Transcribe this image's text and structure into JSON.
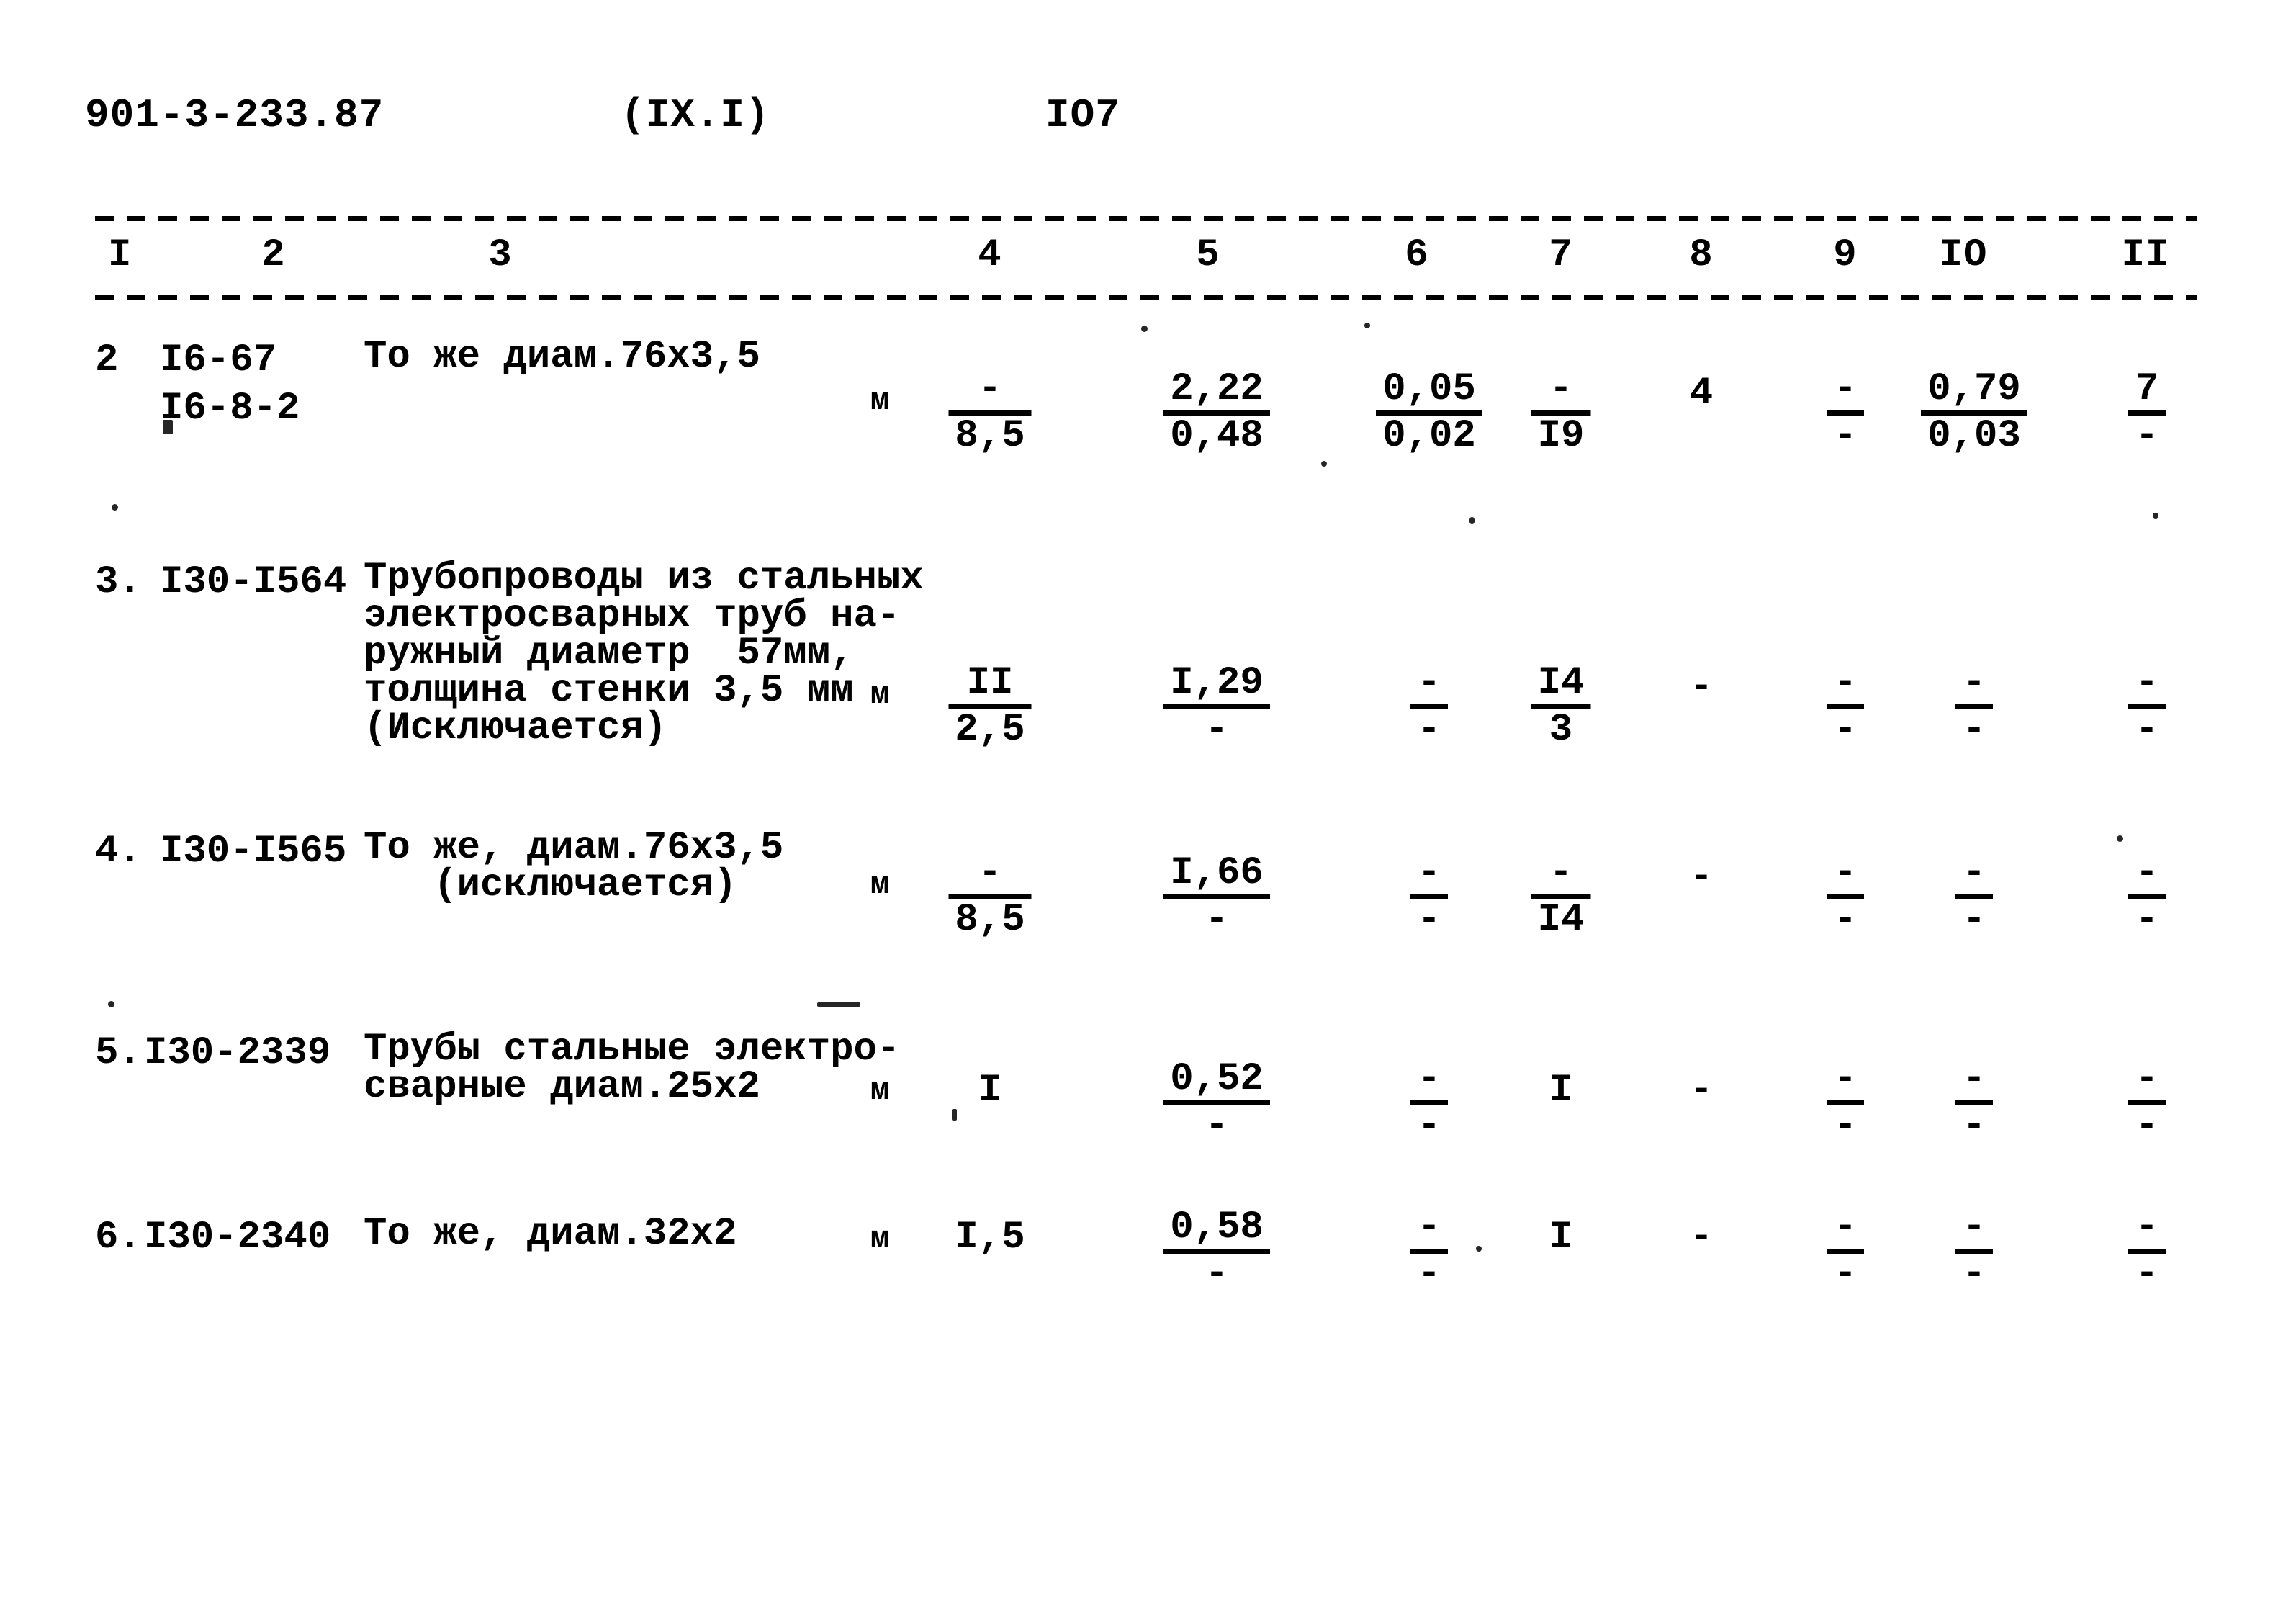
{
  "header": {
    "doc_code": "901-3-233.87",
    "section": "(IX.I)",
    "page_number": "IO7"
  },
  "table": {
    "column_headers": [
      "I",
      "2",
      "3",
      "4",
      "5",
      "6",
      "7",
      "8",
      "9",
      "IO",
      "II"
    ],
    "rows": [
      {
        "no": "2",
        "code_line1": "I6-67",
        "code_line2": "I6-8-2",
        "description": "То же диам.76х3,5",
        "unit": "м",
        "c4_top": "-",
        "c4_bot": "8,5",
        "c5_top": "2,22",
        "c5_bot": "0,48",
        "c6_top": "0,05",
        "c6_bot": "0,02",
        "c7_top": "-",
        "c7_bot": "I9",
        "c8": "4",
        "c9_top": "-",
        "c9_bot": "-",
        "c10_top": "0,79",
        "c10_bot": "0,03",
        "c11_top": "7",
        "c11_bot": "-"
      },
      {
        "no": "3.",
        "code_line1": "I30-I564",
        "code_line2": "",
        "description": "Трубопроводы из стальных\nэлектросварных труб на-\nружный диаметр  57мм,\nтолщина стенки 3,5 мм\n(Исключается)",
        "unit": "м",
        "c4_top": "II",
        "c4_bot": "2,5",
        "c5_top": "I,29",
        "c5_bot": "-",
        "c6_top": "-",
        "c6_bot": "-",
        "c7_top": "I4",
        "c7_bot": "3",
        "c8": "-",
        "c9_top": "-",
        "c9_bot": "-",
        "c10_top": "-",
        "c10_bot": "-",
        "c11_top": "-",
        "c11_bot": "-"
      },
      {
        "no": "4.",
        "code_line1": "I30-I565",
        "code_line2": "",
        "description": "То же, диам.76х3,5\n   (исключается)",
        "unit": "м",
        "c4_top": "-",
        "c4_bot": "8,5",
        "c5_top": "I,66",
        "c5_bot": "-",
        "c6_top": "-",
        "c6_bot": "-",
        "c7_top": "-",
        "c7_bot": "I4",
        "c8": "-",
        "c9_top": "-",
        "c9_bot": "-",
        "c10_top": "-",
        "c10_bot": "-",
        "c11_top": "-",
        "c11_bot": "-"
      },
      {
        "no": "5.",
        "code_line1": "I30-2339",
        "code_line2": "",
        "description": "Трубы стальные электро-\nсварные диам.25х2",
        "unit": "м",
        "c4_single": "I",
        "c5_top": "0,52",
        "c5_bot": "-",
        "c6_top": "-",
        "c6_bot": "-",
        "c7_single": "I",
        "c8": "-",
        "c9_top": "-",
        "c9_bot": "-",
        "c10_top": "-",
        "c10_bot": "-",
        "c11_top": "-",
        "c11_bot": "-"
      },
      {
        "no": "6.",
        "code_line1": "I30-2340",
        "code_line2": "",
        "description": "То же, диам.32х2",
        "unit": "м",
        "c4_single": "I,5",
        "c5_top": "0,58",
        "c5_bot": "-",
        "c6_top": "-",
        "c6_bot": "-",
        "c7_single": "I",
        "c8": "-",
        "c9_top": "-",
        "c9_bot": "-",
        "c10_top": "-",
        "c10_bot": "-",
        "c11_top": "-",
        "c11_bot": "-"
      }
    ]
  }
}
